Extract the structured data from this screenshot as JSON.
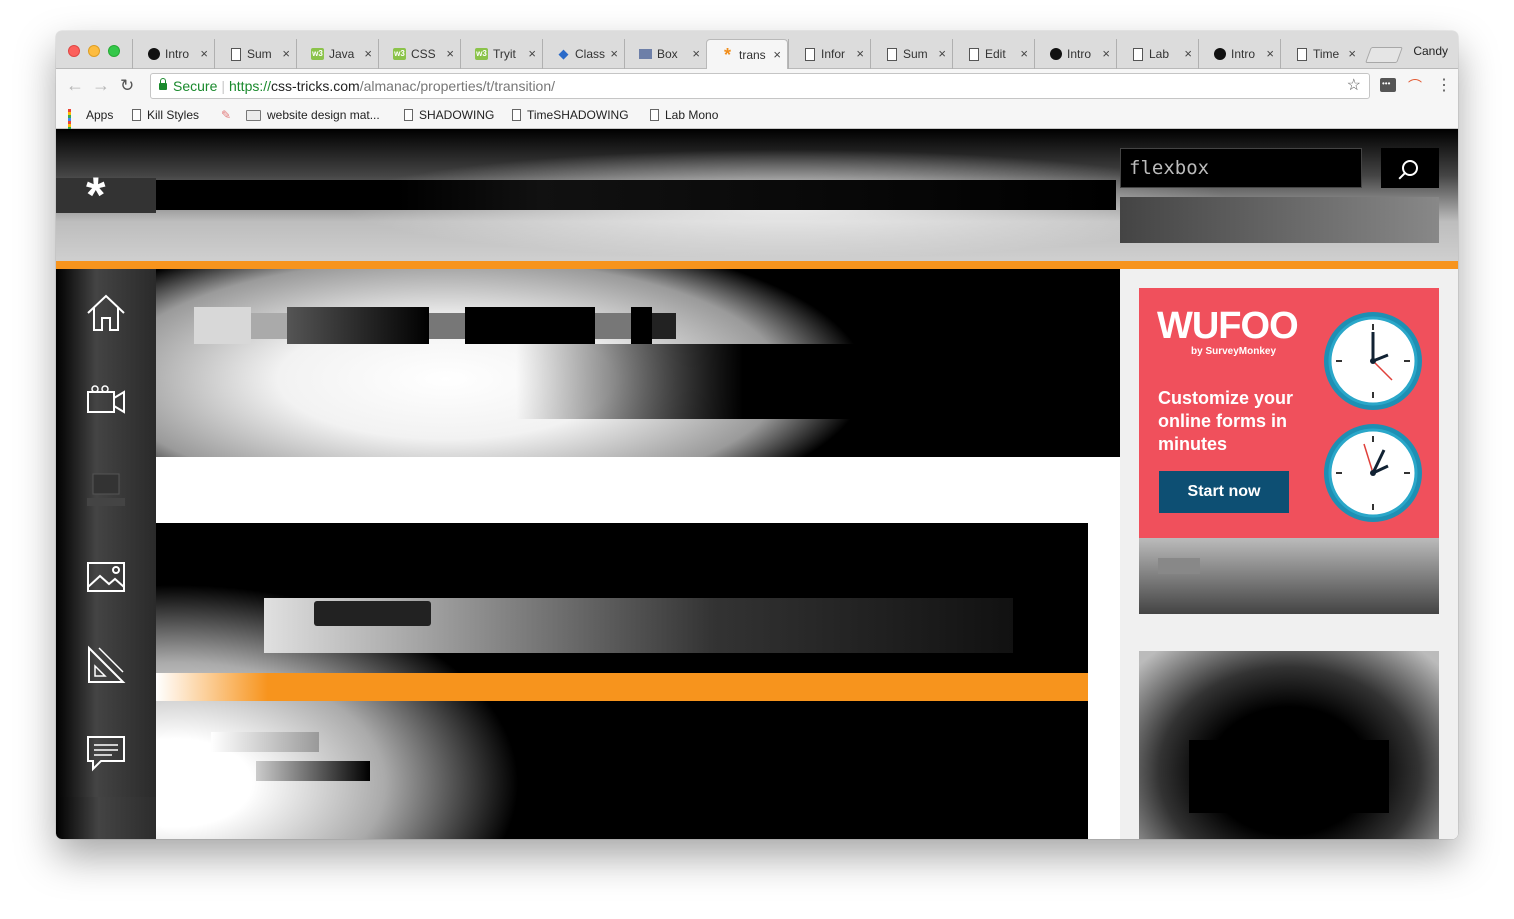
{
  "browser": {
    "tabs": [
      {
        "label": "Intro",
        "icon": "dot-favicon"
      },
      {
        "label": "Sum",
        "icon": "doc-favicon"
      },
      {
        "label": "Java",
        "icon": "w3-favicon"
      },
      {
        "label": "CSS",
        "icon": "w3-favicon"
      },
      {
        "label": "Tryit",
        "icon": "w3-favicon"
      },
      {
        "label": "Class",
        "icon": "layers-favicon"
      },
      {
        "label": "Box",
        "icon": "box-favicon"
      },
      {
        "label": "trans",
        "icon": "star-favicon",
        "active": true
      },
      {
        "label": "Infor",
        "icon": "doc-favicon"
      },
      {
        "label": "Sum",
        "icon": "doc-favicon"
      },
      {
        "label": "Edit",
        "icon": "doc-favicon"
      },
      {
        "label": "Intro",
        "icon": "dot-favicon"
      },
      {
        "label": "Lab",
        "icon": "doc-favicon"
      },
      {
        "label": "Intro",
        "icon": "dot-favicon"
      },
      {
        "label": "Time",
        "icon": "doc-favicon"
      }
    ],
    "close_glyph": "×",
    "profile_name": "Candy",
    "secure_label": "Secure",
    "url": {
      "scheme": "https://",
      "host": "css-tricks.com",
      "path": "/almanac/properties/t/transition/"
    },
    "bookmarks": [
      {
        "label": "Apps",
        "icon": "apps-grid-icon"
      },
      {
        "label": "Kill Styles",
        "icon": "doc-icon"
      },
      {
        "label": "",
        "icon": "feather-icon"
      },
      {
        "label": "website design mat...",
        "icon": "folder-icon"
      },
      {
        "label": "SHADOWING",
        "icon": "doc-icon"
      },
      {
        "label": "TimeSHADOWING",
        "icon": "doc-icon"
      },
      {
        "label": "Lab Mono",
        "icon": "doc-icon"
      }
    ]
  },
  "site": {
    "logo_glyph": "*",
    "search": {
      "value": "flexbox"
    },
    "rail_icons": [
      "home-icon",
      "video-icon",
      "laptop-icon",
      "image-icon",
      "design-tools-icon",
      "chat-icon"
    ],
    "ad": {
      "logo": "WUFOO",
      "sub": "by SurveyMonkey",
      "copy": "Customize your online forms in minutes",
      "cta": "Start now",
      "colors": {
        "background": "#f0505c",
        "button": "#0d4f73",
        "clock_rim": "#2aa7c9"
      }
    }
  },
  "colors": {
    "accent": "#f7941d"
  }
}
